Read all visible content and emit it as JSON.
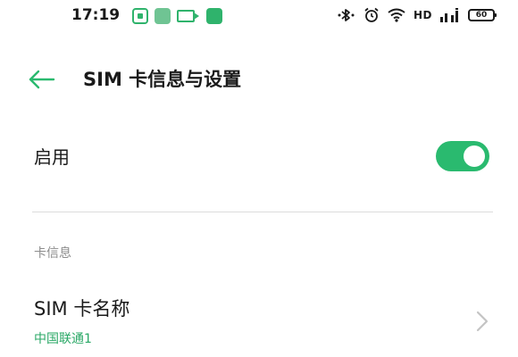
{
  "status_bar": {
    "time": "17:19",
    "hd": "HD",
    "battery": "60"
  },
  "header": {
    "title": "SIM 卡信息与设置",
    "back_icon": "back-arrow-icon"
  },
  "enable_row": {
    "label": "启用",
    "toggle_on": true
  },
  "section": {
    "card_info_label": "卡信息"
  },
  "sim_name_row": {
    "title": "SIM 卡名称",
    "value": "中国联通1",
    "chevron_icon": "chevron-right-icon"
  },
  "colors": {
    "accent": "#2aba6f",
    "value_text": "#2aa866",
    "section_label": "#8c8c8c"
  }
}
